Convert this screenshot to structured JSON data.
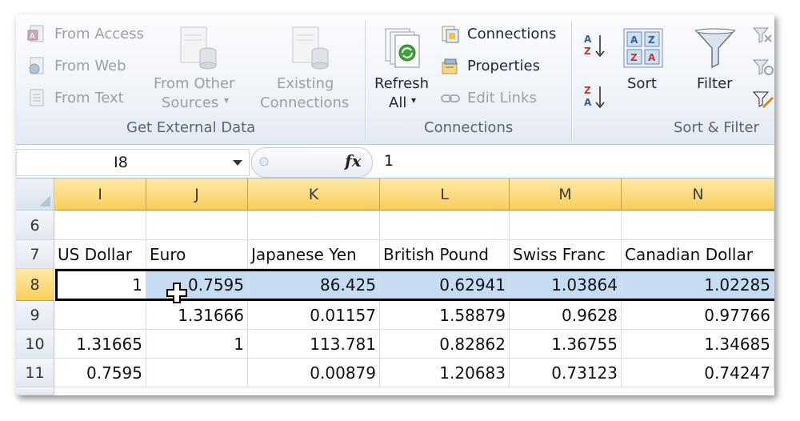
{
  "ribbon": {
    "get_external": {
      "from_access": "From Access",
      "from_web": "From Web",
      "from_text": "From Text",
      "from_other_1": "From Other",
      "from_other_2": "Sources",
      "existing_1": "Existing",
      "existing_2": "Connections",
      "group_label": "Get External Data"
    },
    "connections": {
      "refresh_1": "Refresh",
      "refresh_2": "All",
      "connections": "Connections",
      "properties": "Properties",
      "edit_links": "Edit Links",
      "group_label": "Connections"
    },
    "sort_filter": {
      "sort": "Sort",
      "filter": "Filter",
      "group_label": "Sort & Filter"
    }
  },
  "formula_bar": {
    "name_box": "I8",
    "fx": "fx",
    "value": "1"
  },
  "grid": {
    "columns": [
      "I",
      "J",
      "K",
      "L",
      "M",
      "N"
    ],
    "rows": [
      {
        "num": "6",
        "cells": [
          "",
          "",
          "",
          "",
          "",
          ""
        ]
      },
      {
        "num": "7",
        "cells": [
          "US Dollar",
          "Euro",
          "Japanese Yen",
          "British Pound",
          "Swiss Franc",
          "Canadian Dollar"
        ]
      },
      {
        "num": "8",
        "cells": [
          "1",
          "0.7595",
          "86.425",
          "0.62941",
          "1.03864",
          "1.02285"
        ]
      },
      {
        "num": "9",
        "cells": [
          "",
          "1.31666",
          "0.01157",
          "1.58879",
          "0.9628",
          "0.97766"
        ]
      },
      {
        "num": "10",
        "cells": [
          "1.31665",
          "1",
          "113.781",
          "0.82862",
          "1.36755",
          "1.34685"
        ]
      },
      {
        "num": "11",
        "cells": [
          "0.7595",
          "",
          "0.00879",
          "1.20683",
          "0.73123",
          "0.74247"
        ]
      }
    ]
  },
  "colors": {
    "column_header": "#f9cf5b",
    "selected_row_highlight": "#c5dcf3"
  }
}
